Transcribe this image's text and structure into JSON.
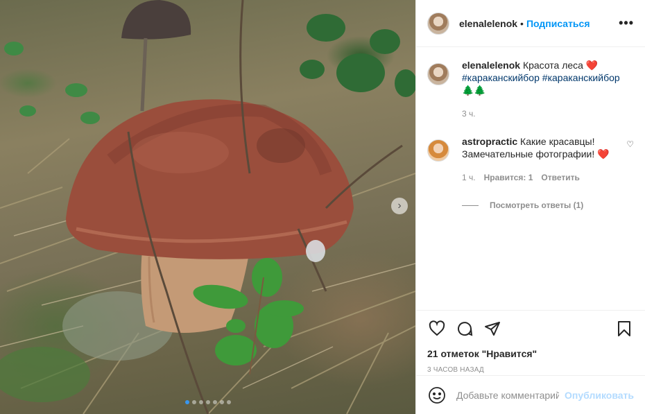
{
  "post": {
    "author": "elenalelenok",
    "follow_label": "Подписаться",
    "separator": "•",
    "more_label": "•••",
    "photo": {
      "slide_count": 7,
      "active_slide": 1
    }
  },
  "caption": {
    "user": "elenalelenok",
    "text": "Красота леса",
    "hashtags": [
      "#караканскийбор",
      "#караканскийбор"
    ],
    "emoji": "🌲🌲",
    "time": "3 ч."
  },
  "comments": [
    {
      "user": "astropractic",
      "text": "Какие красавцы! Замечательные фотографии!",
      "time": "1 ч.",
      "likes_label": "Нравится: 1",
      "reply_label": "Ответить",
      "view_replies_label": "Посмотреть ответы (1)"
    }
  ],
  "actions": {
    "likes_text": "21 отметок \"Нравится\"",
    "timestamp": "3 ЧАСОВ НАЗАД"
  },
  "add_comment": {
    "placeholder": "Добавьте комментарий...",
    "publish_label": "Опубликовать"
  },
  "colors": {
    "accent": "#0095f6",
    "heart": "#ed4956",
    "hashtag": "#00376b",
    "muted": "#8e8e8e",
    "publish_disabled": "#b3dbff"
  },
  "icons": [
    "more-icon",
    "heart-icon",
    "comment-icon",
    "share-icon",
    "bookmark-icon",
    "emoji-icon",
    "chevron-right-icon"
  ]
}
